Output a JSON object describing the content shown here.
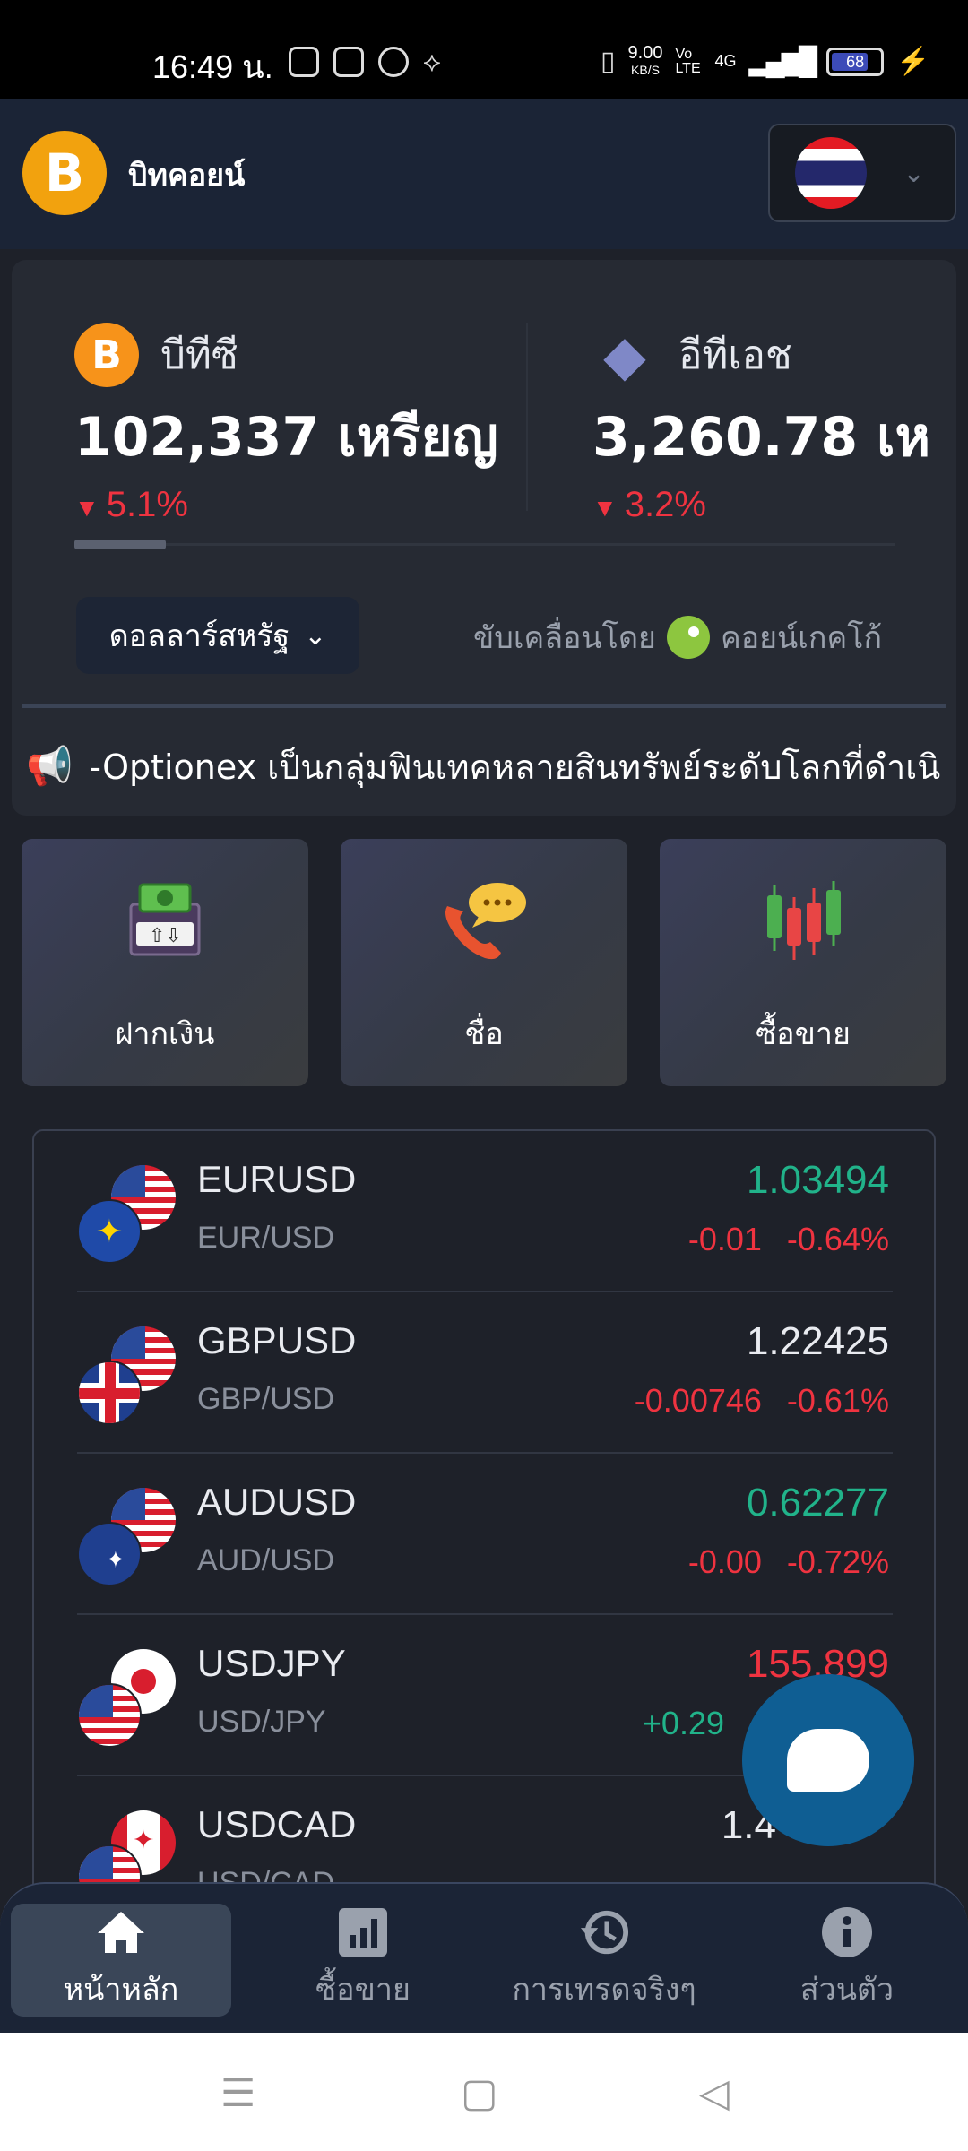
{
  "status_bar": {
    "time": "16:49 น.",
    "speed_value": "9.00",
    "speed_unit": "KB/S",
    "volte": "Vo LTE",
    "network": "4G",
    "battery": "68"
  },
  "header": {
    "app_name": "บิทคอยน์",
    "logo_letter": "B"
  },
  "ticker": {
    "coins": [
      {
        "symbol_icon": "B",
        "name": "บีทีซี",
        "price": "102,337 เหรียญ",
        "change": "5.1%"
      },
      {
        "symbol_icon": "◆",
        "name": "อีทีเอช",
        "price": "3,260.78 เห",
        "change": "3.2%"
      }
    ],
    "currency_label": "ดอลลาร์สหรัฐ",
    "powered_by_label": "ขับเคลื่อนโดย",
    "powered_by_brand": "คอยน์เกคโก้",
    "announcement": "-Optionex เป็นกลุ่มฟินเทคหลายสินทรัพย์ระดับโลกที่ดำเนิ"
  },
  "actions": [
    {
      "label": "ฝากเงิน",
      "icon": "deposit-icon"
    },
    {
      "label": "ชื่อ",
      "icon": "phone-chat-icon"
    },
    {
      "label": "ซื้อขาย",
      "icon": "candlestick-icon"
    }
  ],
  "forex": [
    {
      "symbol": "EURUSD",
      "pair": "EUR/USD",
      "price": "1.03494",
      "change": "-0.01",
      "percent": "-0.64%",
      "price_color": "green"
    },
    {
      "symbol": "GBPUSD",
      "pair": "GBP/USD",
      "price": "1.22425",
      "change": "-0.00746",
      "percent": "-0.61%",
      "price_color": "white"
    },
    {
      "symbol": "AUDUSD",
      "pair": "AUD/USD",
      "price": "0.62277",
      "change": "-0.00",
      "percent": "-0.72%",
      "price_color": "green"
    },
    {
      "symbol": "USDJPY",
      "pair": "USD/JPY",
      "price": "155.899",
      "change": "+0.29",
      "percent": "",
      "price_color": "red"
    },
    {
      "symbol": "USDCAD",
      "pair": "USD/CAD",
      "price": "1.4",
      "change": "",
      "percent": "",
      "price_color": "white"
    }
  ],
  "bottom_nav": [
    {
      "label": "หน้าหลัก",
      "icon": "home-icon",
      "active": true
    },
    {
      "label": "ซื้อขาย",
      "icon": "chart-icon",
      "active": false
    },
    {
      "label": "การเทรดจริงๆ",
      "icon": "history-icon",
      "active": false
    },
    {
      "label": "ส่วนตัว",
      "icon": "info-icon",
      "active": false
    }
  ],
  "colors": {
    "bg": "#1e2129",
    "header": "#1b2436",
    "positive": "#21b38a",
    "negative": "#ef3340",
    "btc": "#f7931a",
    "chat": "#0f5e93"
  }
}
